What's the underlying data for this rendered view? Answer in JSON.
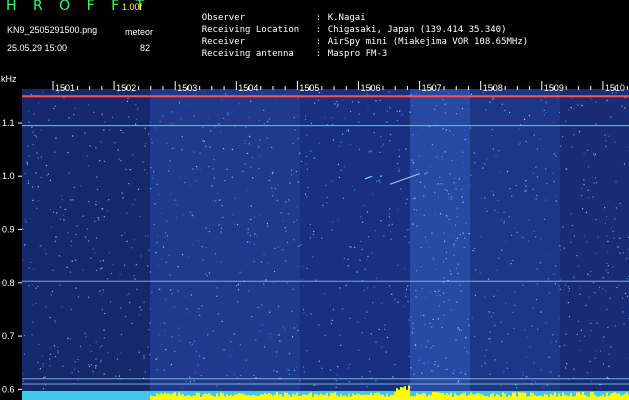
{
  "header": {
    "title": "H R O F F T",
    "version": "1.00f",
    "filename": "KN9_2505291500.png",
    "datetime": "25.05.29 15:00",
    "meteor_label": "meteor",
    "meteor_count": "82"
  },
  "info": [
    {
      "label": "Observer",
      "value": "K.Nagai"
    },
    {
      "label": "Receiving Location",
      "value": "Chigasaki, Japan (139.414 35.340)"
    },
    {
      "label": "Receiver",
      "value": "AirSpy mini (Miakejima VOR 108.65MHz)"
    },
    {
      "label": "Receiving antenna",
      "value": "Maspro FM-3"
    }
  ],
  "chart_data": {
    "type": "heatmap",
    "ylabel": "kHz",
    "x_ticks": [
      "1501",
      "1502",
      "1503",
      "1504",
      "1505",
      "1506",
      "1507",
      "1508",
      "1509",
      "1510"
    ],
    "y_ticks": [
      "1.1",
      "1.0",
      "0.9",
      "0.8",
      "0.7",
      "0.6"
    ],
    "ylim": [
      0.58,
      1.175
    ],
    "carrier_lines_khz": [
      1.15,
      1.095,
      0.803,
      0.62,
      0.61
    ],
    "colors": {
      "background": "#1b2f7a",
      "axis_bar": "#ffff00",
      "carrier": "#ff5050",
      "line": "#a0e0ff"
    }
  }
}
